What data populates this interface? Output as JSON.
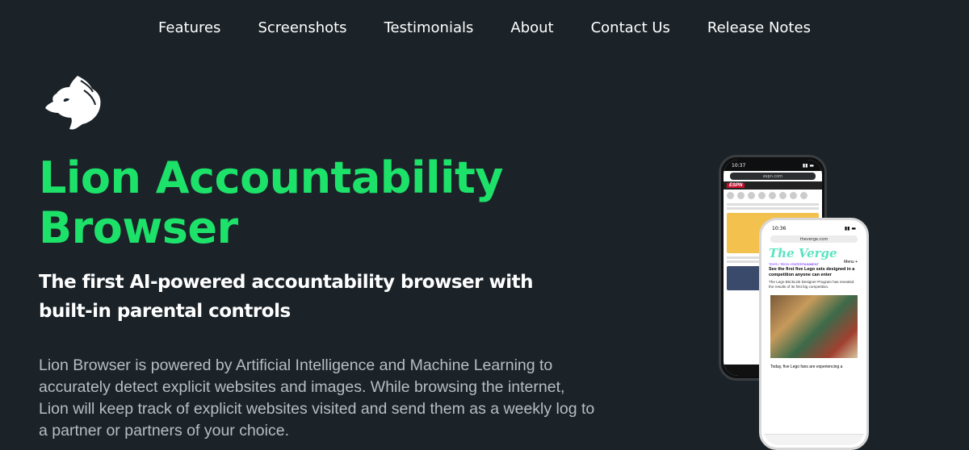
{
  "nav": {
    "items": [
      "Features",
      "Screenshots",
      "Testimonials",
      "About",
      "Contact Us",
      "Release Notes"
    ]
  },
  "logo": {
    "icon": "lion-head-icon"
  },
  "hero": {
    "title": "Lion Accountability Browser",
    "subtitle": "The first AI-powered accountability browser with built-in parental controls",
    "description": "Lion Browser is powered by Artificial Intelligence and Machine Learning to accurately detect explicit websites and images. While browsing the internet, Lion will keep track of explicit websites visited and send them as a weekly log to a partner or partners of your choice."
  },
  "phones": {
    "back": {
      "time": "10:37",
      "url": "espn.com",
      "logo": "ESPN"
    },
    "front": {
      "time": "10:36",
      "url": "theverge.com",
      "logo": "The Verge",
      "menu": "Menu +",
      "tag": "TOYS / TECH / ENTERTAINMENT",
      "headline": "See the first five Lego sets designed in a competition anyone can enter",
      "subhead": "The Lego BrickLink Designer Program has revealed the results of its first big competition.",
      "body": "Today, five Lego fans are experiencing a"
    }
  },
  "colors": {
    "background": "#1b2329",
    "accent": "#1de26a",
    "text": "#ffffff",
    "muted": "#b7bdc2"
  }
}
